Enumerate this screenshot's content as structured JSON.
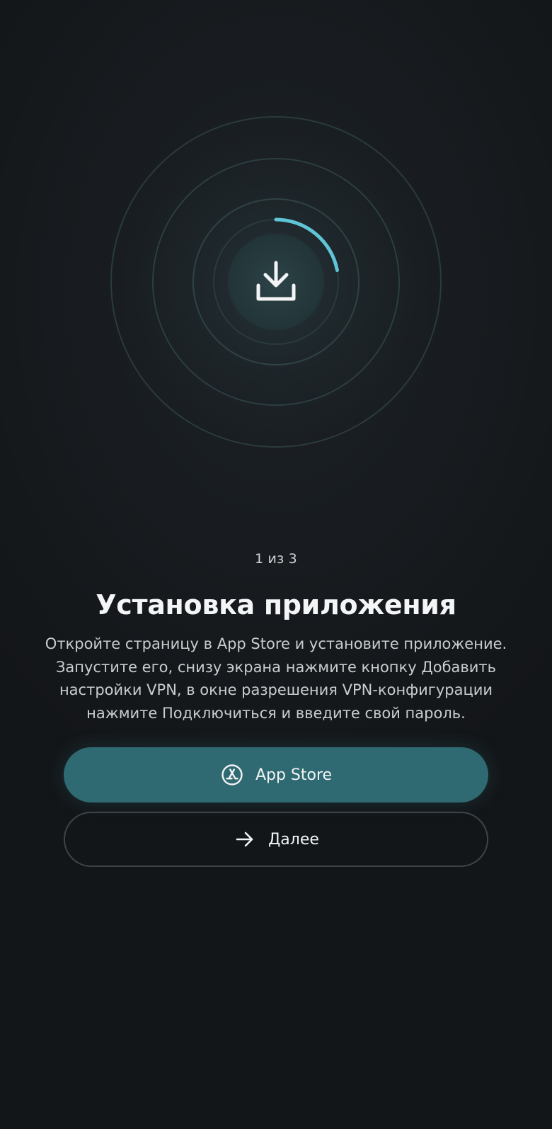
{
  "onboarding": {
    "step": "1 из 3",
    "title": "Установка приложения",
    "description": "Откройте страницу в App Store и установите приложение. Запустите его, снизу экрана нажмите кнопку Добавить настройки VPN, в окне разрешения VPN-конфигурации нажмите Подключиться и введите свой пароль."
  },
  "illustration": {
    "icon": "download-icon",
    "progress_fraction": 0.22
  },
  "buttons": {
    "app_store": {
      "label": "App Store",
      "icon": "app-store-icon"
    },
    "next": {
      "label": "Далее",
      "icon": "arrow-right-icon"
    }
  },
  "colors": {
    "background": "#15181c",
    "accent": "#5fc4d6",
    "primary_button": "#2f6a73"
  }
}
